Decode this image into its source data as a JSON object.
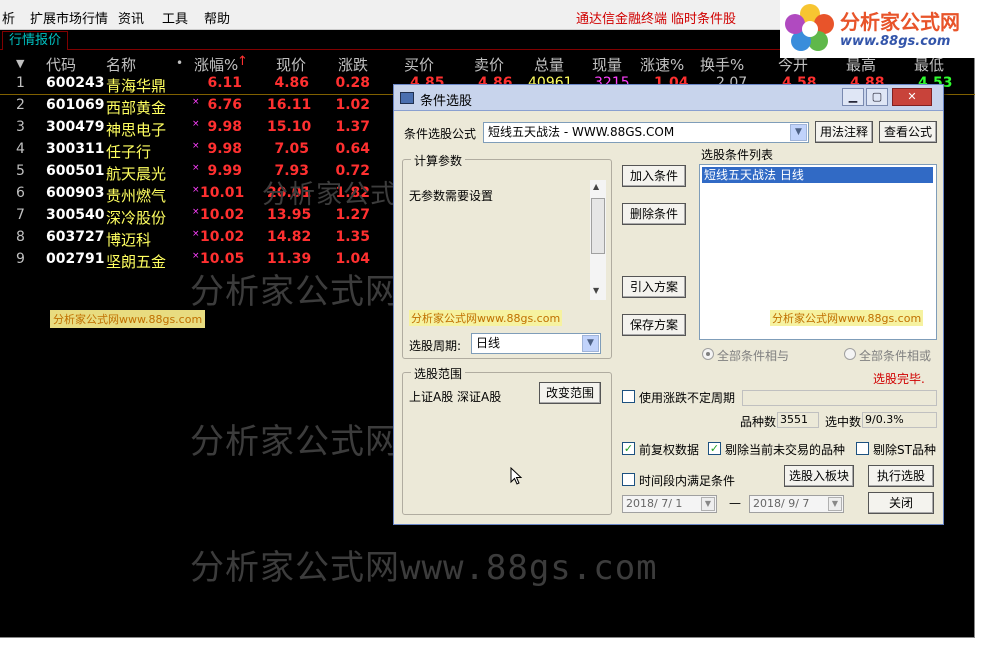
{
  "menu": {
    "items": [
      "析",
      "扩展市场行情",
      "资讯",
      "工具",
      "帮助"
    ],
    "red_links": [
      "通达信金融终端",
      "临时条件股"
    ]
  },
  "logo": {
    "title": "分析家公式网",
    "url": "www.88gs.com"
  },
  "tab": {
    "label": "行情报价"
  },
  "table": {
    "headers": [
      "代码",
      "名称",
      "•",
      "涨幅%",
      "现价",
      "涨跌",
      "买价",
      "卖价",
      "总量",
      "现量",
      "涨速%",
      "换手%",
      "今开",
      "最高",
      "最低"
    ],
    "rows": [
      {
        "idx": "1",
        "code": "600243",
        "name": "青海华鼎",
        "mark": "",
        "pct": "6.11",
        "price": "4.86",
        "chg": "0.28"
      },
      {
        "idx": "2",
        "code": "601069",
        "name": "西部黄金",
        "mark": "×",
        "pct": "6.76",
        "price": "16.11",
        "chg": "1.02"
      },
      {
        "idx": "3",
        "code": "300479",
        "name": "神思电子",
        "mark": "×",
        "pct": "9.98",
        "price": "15.10",
        "chg": "1.37"
      },
      {
        "idx": "4",
        "code": "300311",
        "name": "任子行",
        "mark": "×",
        "pct": "9.98",
        "price": "7.05",
        "chg": "0.64"
      },
      {
        "idx": "5",
        "code": "600501",
        "name": "航天晨光",
        "mark": "×",
        "pct": "9.99",
        "price": "7.93",
        "chg": "0.72"
      },
      {
        "idx": "6",
        "code": "600903",
        "name": "贵州燃气",
        "mark": "×",
        "pct": "10.01",
        "price": "20.01",
        "chg": "1.82"
      },
      {
        "idx": "7",
        "code": "300540",
        "name": "深冷股份",
        "mark": "×",
        "pct": "10.02",
        "price": "13.95",
        "chg": "1.27"
      },
      {
        "idx": "8",
        "code": "603727",
        "name": "博迈科",
        "mark": "×",
        "pct": "10.02",
        "price": "14.82",
        "chg": "1.35"
      },
      {
        "idx": "9",
        "code": "002791",
        "name": "坚朗五金",
        "mark": "×",
        "pct": "10.05",
        "price": "11.39",
        "chg": "1.04"
      }
    ],
    "partial_row1": [
      "4.85",
      "4.86",
      "40961",
      "3215",
      "1.04",
      "2.07",
      "4.58",
      "4.88",
      "4.53"
    ]
  },
  "watermark": {
    "text": "分析家公式网www.88gs.com",
    "partial": "分析家公式网www.88"
  },
  "dialog": {
    "title": "条件选股",
    "formula_label": "条件选股公式",
    "formula_value": "短线五天战法 - WWW.88GS.COM",
    "btn_usage": "用法注释",
    "btn_view": "查看公式",
    "params_group": "计算参数",
    "params_text": "无参数需要设置",
    "period_label": "选股周期:",
    "period_value": "日线",
    "btn_add": "加入条件",
    "btn_delete": "删除条件",
    "btn_import": "引入方案",
    "btn_save": "保存方案",
    "list_label": "选股条件列表",
    "list_item": "短线五天战法  日线",
    "radio_and": "全部条件相与",
    "radio_or": "全部条件相或",
    "done_text": "选股完毕.",
    "scope_group": "选股范围",
    "scope_value": "上证A股 深证A股",
    "btn_change_scope": "改变范围",
    "chk_variable": "使用涨跌不定周期",
    "count_label": "品种数",
    "count_value": "3551",
    "selected_label": "选中数",
    "selected_value": "9/0.3%",
    "chk_adjust": "前复权数据",
    "chk_exclude_untraded": "剔除当前未交易的品种",
    "chk_exclude_st": "剔除ST品种",
    "chk_time": "时间段内满足条件",
    "btn_to_block": "选股入板块",
    "btn_execute": "执行选股",
    "date_from": "2018/ 7/ 1",
    "date_sep": "—",
    "date_to": "2018/ 9/ 7",
    "btn_close": "关闭",
    "check_mark": "✓"
  }
}
